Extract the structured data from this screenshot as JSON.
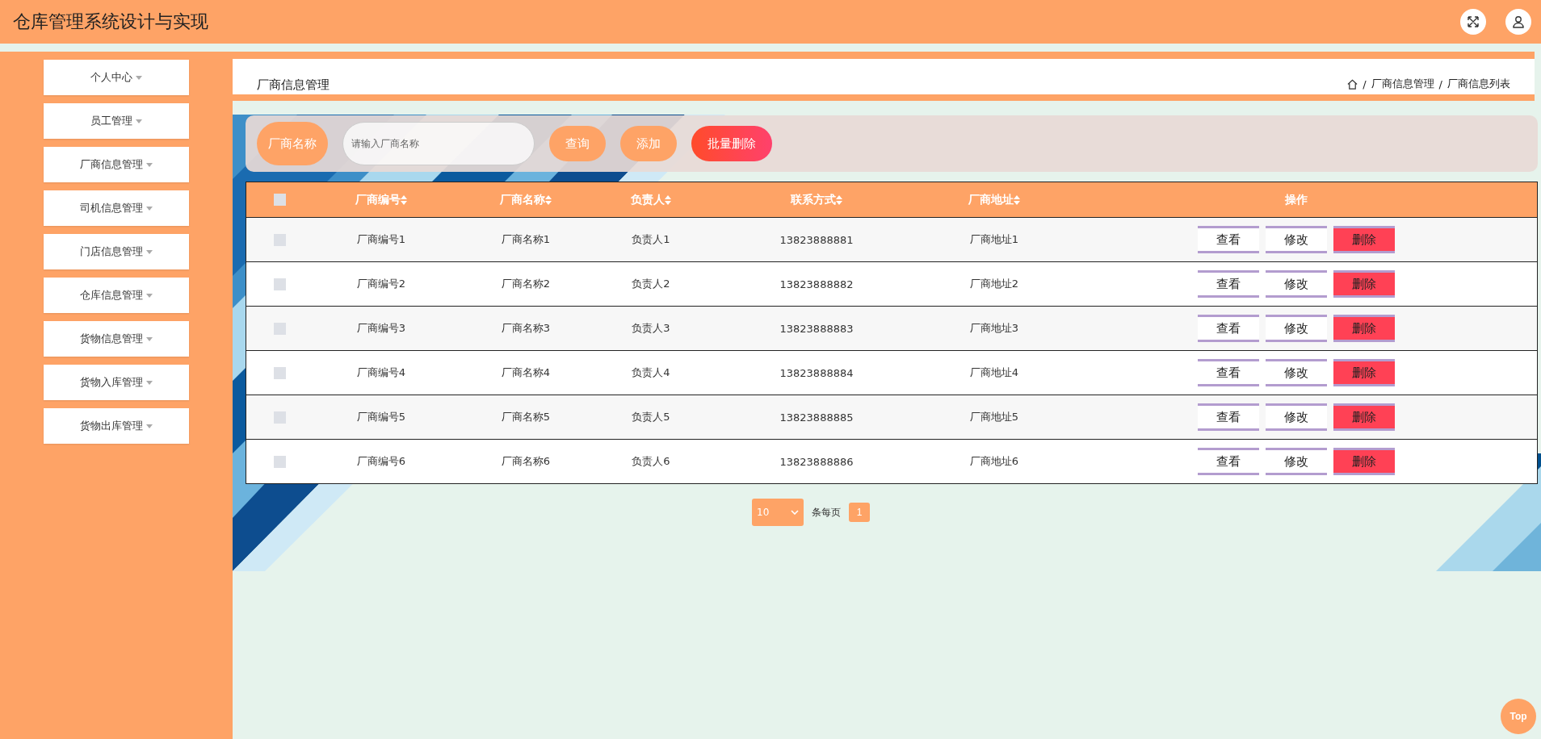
{
  "header": {
    "title": "仓库管理系统设计与实现"
  },
  "sidebar": {
    "items": [
      {
        "label": "个人中心",
        "expanded": false
      },
      {
        "label": "员工管理",
        "expanded": false
      },
      {
        "label": "厂商信息管理",
        "expanded": false
      },
      {
        "label": "司机信息管理",
        "expanded": false
      },
      {
        "label": "门店信息管理",
        "expanded": false
      },
      {
        "label": "仓库信息管理",
        "expanded": false
      },
      {
        "label": "货物信息管理",
        "expanded": false
      },
      {
        "label": "货物入库管理",
        "expanded": false
      },
      {
        "label": "货物出库管理",
        "expanded": false
      }
    ]
  },
  "page_title": "厂商信息管理",
  "breadcrumb": [
    {
      "separator": "/",
      "label": "厂商信息管理"
    },
    {
      "separator": "/",
      "label": "厂商信息列表"
    }
  ],
  "search": {
    "label": "厂商名称",
    "placeholder": "请输入厂商名称",
    "buttons": [
      {
        "label": "查询",
        "kind": "plain"
      },
      {
        "label": "添加",
        "kind": "plain"
      },
      {
        "label": "批量删除",
        "kind": "danger"
      }
    ]
  },
  "table": {
    "select_all_checked": false,
    "columns": [
      {
        "label": "厂商编号",
        "sortable": true
      },
      {
        "label": "厂商名称",
        "sortable": true
      },
      {
        "label": "负责人",
        "sortable": true
      },
      {
        "label": "联系方式",
        "sortable": true
      },
      {
        "label": "厂商地址",
        "sortable": true
      },
      {
        "label": "操作",
        "sortable": false
      }
    ],
    "rows": [
      {
        "checked": false,
        "cells": [
          "厂商编号1",
          "厂商名称1",
          "负责人1",
          "13823888881",
          "厂商地址1"
        ],
        "actions": [
          {
            "label": "查看",
            "kind": "plain"
          },
          {
            "label": "修改",
            "kind": "plain"
          },
          {
            "label": "删除",
            "kind": "danger"
          }
        ]
      },
      {
        "checked": false,
        "cells": [
          "厂商编号2",
          "厂商名称2",
          "负责人2",
          "13823888882",
          "厂商地址2"
        ],
        "actions": [
          {
            "label": "查看",
            "kind": "plain"
          },
          {
            "label": "修改",
            "kind": "plain"
          },
          {
            "label": "删除",
            "kind": "danger"
          }
        ]
      },
      {
        "checked": false,
        "cells": [
          "厂商编号3",
          "厂商名称3",
          "负责人3",
          "13823888883",
          "厂商地址3"
        ],
        "actions": [
          {
            "label": "查看",
            "kind": "plain"
          },
          {
            "label": "修改",
            "kind": "plain"
          },
          {
            "label": "删除",
            "kind": "danger"
          }
        ]
      },
      {
        "checked": false,
        "cells": [
          "厂商编号4",
          "厂商名称4",
          "负责人4",
          "13823888884",
          "厂商地址4"
        ],
        "actions": [
          {
            "label": "查看",
            "kind": "plain"
          },
          {
            "label": "修改",
            "kind": "plain"
          },
          {
            "label": "删除",
            "kind": "danger"
          }
        ]
      },
      {
        "checked": false,
        "cells": [
          "厂商编号5",
          "厂商名称5",
          "负责人5",
          "13823888885",
          "厂商地址5"
        ],
        "actions": [
          {
            "label": "查看",
            "kind": "plain"
          },
          {
            "label": "修改",
            "kind": "plain"
          },
          {
            "label": "删除",
            "kind": "danger"
          }
        ]
      },
      {
        "checked": false,
        "cells": [
          "厂商编号6",
          "厂商名称6",
          "负责人6",
          "13823888886",
          "厂商地址6"
        ],
        "actions": [
          {
            "label": "查看",
            "kind": "plain"
          },
          {
            "label": "修改",
            "kind": "plain"
          },
          {
            "label": "删除",
            "kind": "danger"
          }
        ]
      }
    ]
  },
  "pagination": {
    "page_size": "10",
    "page_size_label": "条每页",
    "pages": [
      {
        "label": "1",
        "selected": true
      }
    ]
  },
  "back_to_top": "Top"
}
